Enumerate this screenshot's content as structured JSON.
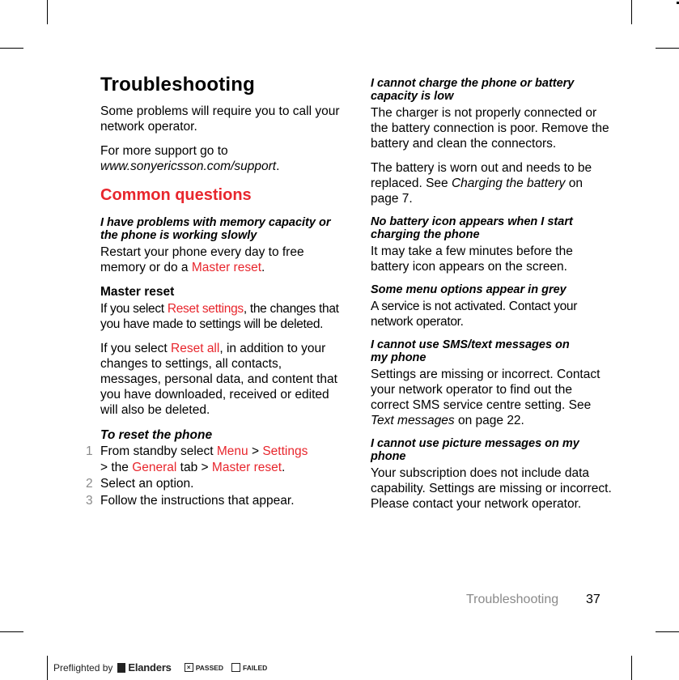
{
  "page": {
    "title": "Troubleshooting",
    "intro_1": "Some problems will require you to call your network operator.",
    "intro_2_prefix": "For more support go to",
    "intro_2_url": "www.sonyericsson.com/support",
    "intro_2_suffix": ".",
    "section_heading": "Common questions",
    "accent_color": "#e8262d"
  },
  "left": {
    "q1": {
      "question": "I have problems with memory capacity or the phone is working slowly",
      "answer_prefix": "Restart your phone every day to free memory or do a ",
      "answer_link": "Master reset",
      "answer_suffix": "."
    },
    "master_reset": {
      "heading": "Master reset",
      "p1_prefix": "If you select ",
      "p1_link": "Reset settings",
      "p1_suffix": ", the changes that you have made to settings will be deleted.",
      "p2_prefix": "If you select ",
      "p2_link": "Reset all",
      "p2_suffix": ", in addition to your changes to settings, all contacts, messages, personal data, and content that you have downloaded, received or edited will also be deleted."
    },
    "procedure": {
      "heading": "To reset the phone",
      "steps": [
        {
          "num": "1",
          "t1": "From standby select ",
          "l1": "Menu",
          "t2": " > ",
          "l2": "Settings",
          "t3": " > the ",
          "l3": "General",
          "t4": " tab > ",
          "l4": "Master reset",
          "t5": "."
        },
        {
          "num": "2",
          "text": "Select an option."
        },
        {
          "num": "3",
          "text": "Follow the instructions that appear."
        }
      ]
    }
  },
  "right": {
    "q2": {
      "question": "I cannot charge the phone or battery capacity is low",
      "answer_1": "The charger is not properly connected or the battery connection is poor. Remove the battery and clean the connectors.",
      "answer_2_prefix": "The battery is worn out and needs to be replaced. See ",
      "answer_2_ref": "Charging the battery",
      "answer_2_suffix": " on page 7."
    },
    "q3": {
      "question": "No battery icon appears when I start charging the phone",
      "answer": "It may take a few minutes before the battery icon appears on the screen."
    },
    "q4": {
      "question": "Some menu options appear in grey",
      "answer": "A service is not activated. Contact your network operator."
    },
    "q5": {
      "question": "I cannot use SMS/text messages on my phone",
      "answer_prefix": "Settings are missing or incorrect. Contact your network operator to find out the correct SMS service centre setting. See ",
      "answer_ref": "Text messages",
      "answer_suffix": " on page 22."
    },
    "q6": {
      "question": "I cannot use picture messages on my phone",
      "answer": "Your subscription does not include data capability. Settings are missing or incorrect. Please contact your network operator."
    }
  },
  "footer": {
    "section": "Troubleshooting",
    "page_number": "37"
  },
  "preflight": {
    "label": "Preflighted by",
    "brand": "Elanders",
    "passed_label": "PASSED",
    "failed_label": "FAILED",
    "passed_mark": "×",
    "failed_mark": ""
  }
}
